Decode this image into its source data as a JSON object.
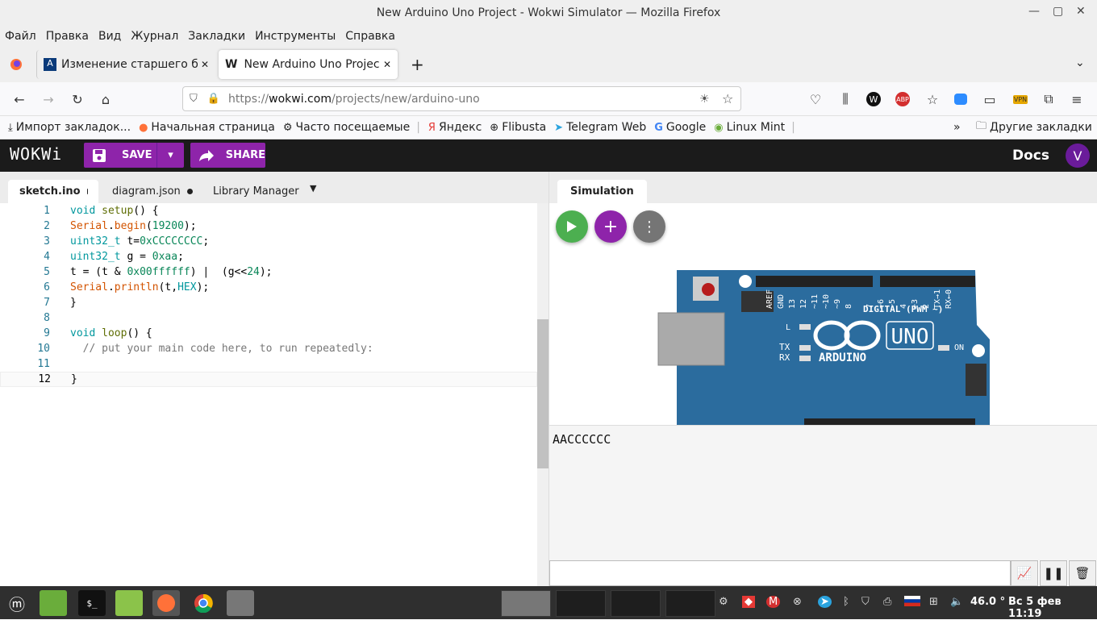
{
  "window": {
    "title": "New Arduino Uno Project - Wokwi Simulator — Mozilla Firefox"
  },
  "menu": [
    "Файл",
    "Правка",
    "Вид",
    "Журнал",
    "Закладки",
    "Инструменты",
    "Справка"
  ],
  "tabs": [
    {
      "label": "Изменение старшего ба"
    },
    {
      "label": "New Arduino Uno Project"
    }
  ],
  "url": {
    "protocol": "https://",
    "host": "wokwi.com",
    "path": "/projects/new/arduino-uno"
  },
  "bookmarks": [
    "Импорт закладок...",
    "Начальная страница",
    "Часто посещаемые",
    "Яндекс",
    "Flibusta",
    "Telegram Web",
    "Google",
    "Linux Mint"
  ],
  "other_bookmarks": "Другие закладки",
  "wokwi": {
    "logo": "WOKWi",
    "save": "SAVE",
    "share": "SHARE",
    "docs": "Docs",
    "avatar": "V"
  },
  "editor": {
    "tabs": [
      "sketch.ino",
      "diagram.json",
      "Library Manager"
    ],
    "lines": [
      {
        "n": "1",
        "text": "void setup() {"
      },
      {
        "n": "2",
        "text": "Serial.begin(19200);"
      },
      {
        "n": "3",
        "text": "uint32_t t=0xCCCCCCCC;"
      },
      {
        "n": "4",
        "text": "uint32_t g = 0xaa;"
      },
      {
        "n": "5",
        "text": "t = (t & 0x00ffffff) |  (g<<24);"
      },
      {
        "n": "6",
        "text": "Serial.println(t,HEX);"
      },
      {
        "n": "7",
        "text": "}"
      },
      {
        "n": "8",
        "text": ""
      },
      {
        "n": "9",
        "text": "void loop() {"
      },
      {
        "n": "10",
        "text": "  // put your main code here, to run repeatedly:"
      },
      {
        "n": "11",
        "text": ""
      },
      {
        "n": "12",
        "text": "}"
      }
    ]
  },
  "simulation": {
    "tab": "Simulation",
    "board": {
      "brand": "ARDUINO",
      "model": "UNO",
      "digital_label": "DIGITAL (PWM ~)",
      "pins": [
        "AREF",
        "GND",
        "13",
        "12",
        "~11",
        "~10",
        "~9",
        "8",
        "7",
        "~6",
        "~5",
        "4",
        "~3",
        "2",
        "TX→1",
        "RX←0"
      ],
      "led_l": "L",
      "tx": "TX",
      "rx": "RX",
      "on": "ON"
    },
    "serial_output": "AACCCCCC"
  },
  "taskbar": {
    "temp": "46.0 °",
    "datetime": "Вс 5 фев 11:19"
  },
  "colors": {
    "wokwi_purple": "#8e24aa",
    "play_green": "#4caf50",
    "board_blue": "#2b6c9e"
  }
}
